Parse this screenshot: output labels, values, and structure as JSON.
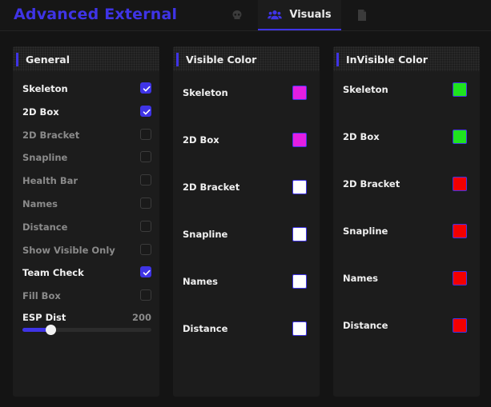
{
  "app": {
    "title": "Advanced External"
  },
  "tabs": [
    {
      "id": "aimbot",
      "icon": "skull-icon",
      "label": ""
    },
    {
      "id": "visuals",
      "icon": "users-icon",
      "label": "Visuals",
      "active": true
    },
    {
      "id": "misc",
      "icon": "document-icon",
      "label": ""
    }
  ],
  "colors": {
    "accent": "#3f34e6",
    "text_on": "#f0f0f0",
    "text_off": "#8a8a8a"
  },
  "general": {
    "title": "General",
    "items": [
      {
        "label": "Skeleton",
        "checked": true
      },
      {
        "label": "2D Box",
        "checked": true
      },
      {
        "label": "2D Bracket",
        "checked": false
      },
      {
        "label": "Snapline",
        "checked": false
      },
      {
        "label": "Health Bar",
        "checked": false
      },
      {
        "label": "Names",
        "checked": false
      },
      {
        "label": "Distance",
        "checked": false
      },
      {
        "label": "Show Visible Only",
        "checked": false
      },
      {
        "label": "Team Check",
        "checked": true
      },
      {
        "label": "Fill Box",
        "checked": false
      }
    ],
    "esp_dist": {
      "label": "ESP Dist",
      "value": "200",
      "fraction": 0.22
    }
  },
  "visible_color": {
    "title": "Visible Color",
    "items": [
      {
        "label": "Skeleton",
        "color": "#e31ee3"
      },
      {
        "label": "2D Box",
        "color": "#e31ee3"
      },
      {
        "label": "2D Bracket",
        "color": "#ffffff"
      },
      {
        "label": "Snapline",
        "color": "#ffffff"
      },
      {
        "label": "Names",
        "color": "#ffffff"
      },
      {
        "label": "Distance",
        "color": "#ffffff"
      }
    ]
  },
  "invisible_color": {
    "title": "InVisible Color",
    "items": [
      {
        "label": "Skeleton",
        "color": "#1fe31f"
      },
      {
        "label": "2D Box",
        "color": "#1fe31f"
      },
      {
        "label": "2D Bracket",
        "color": "#f20000"
      },
      {
        "label": "Snapline",
        "color": "#f20000"
      },
      {
        "label": "Names",
        "color": "#f20000"
      },
      {
        "label": "Distance",
        "color": "#f20000"
      }
    ]
  }
}
